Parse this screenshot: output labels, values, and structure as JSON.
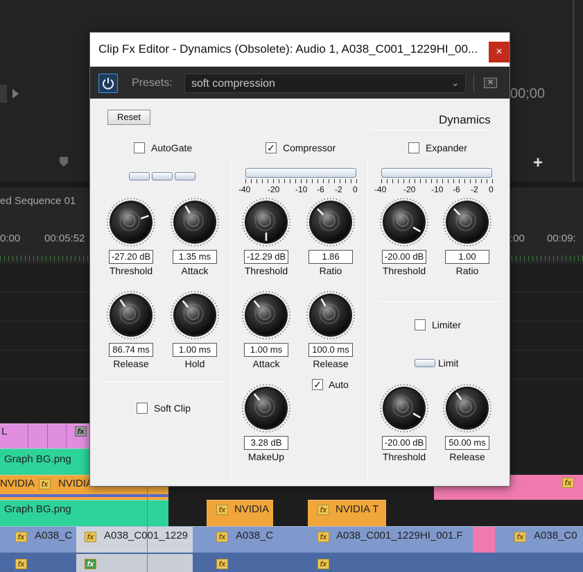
{
  "background": {
    "timecode_top": "00;00",
    "sequence_name": "ed Sequence 01",
    "ruler_ticks": [
      "0:00",
      "00:05:52",
      ":00",
      "00:09:"
    ],
    "clips": {
      "graph_bg_1": "Graph BG.png",
      "graph_bg_2": "Graph BG.png",
      "nvidia_left": "NVIDIA",
      "nvidia_mid": "NVIDIA",
      "nvidia_a": "NVIDIA",
      "nvidia_b": "NVIDIA T",
      "a038_1": "A038_C",
      "a038_2": "A038_C001_1229",
      "a038_3": "A038_C",
      "a038_4": "A038_C001_1229HI_001.F",
      "a038_5": "A038_C0",
      "l": "L"
    }
  },
  "dialog": {
    "title": "Clip Fx Editor - Dynamics (Obsolete): Audio 1, A038_C001_1229HI_00...",
    "close_glyph": "×",
    "presets_label": "Presets:",
    "preset_value": "soft compression",
    "reset_label": "Reset",
    "heading": "Dynamics",
    "autogate": {
      "label": "AutoGate",
      "checked": false,
      "threshold": {
        "value": "-27.20 dB",
        "label": "Threshold"
      },
      "attack": {
        "value": "1.35 ms",
        "label": "Attack"
      },
      "release": {
        "value": "86.74 ms",
        "label": "Release"
      },
      "hold": {
        "value": "1.00 ms",
        "label": "Hold"
      }
    },
    "soft_clip": {
      "label": "Soft Clip",
      "checked": false
    },
    "compressor": {
      "label": "Compressor",
      "checked": true,
      "scale": [
        "-40",
        "-20",
        "-10",
        "-6",
        "-2",
        "0"
      ],
      "threshold": {
        "value": "-12.29 dB",
        "label": "Threshold"
      },
      "ratio": {
        "value": "1.86",
        "label": "Ratio"
      },
      "attack": {
        "value": "1.00 ms",
        "label": "Attack"
      },
      "release": {
        "value": "100.0 ms",
        "label": "Release"
      },
      "auto_label": "Auto",
      "auto_checked": true,
      "makeup": {
        "value": "3.28 dB",
        "label": "MakeUp"
      }
    },
    "expander": {
      "label": "Expander",
      "checked": false,
      "scale": [
        "-40",
        "-20",
        "-10",
        "-6",
        "-2",
        "0"
      ],
      "threshold": {
        "value": "-20.00 dB",
        "label": "Threshold"
      },
      "ratio": {
        "value": "1.00",
        "label": "Ratio"
      }
    },
    "limiter": {
      "label": "Limiter",
      "checked": false,
      "limit_label": "Limit",
      "threshold": {
        "value": "-20.00 dB",
        "label": "Threshold"
      },
      "release": {
        "value": "50.00 ms",
        "label": "Release"
      }
    },
    "colors": {
      "close": "#c42b1c",
      "power": "#4a8fe0",
      "panel": "#f0f0f0"
    }
  }
}
